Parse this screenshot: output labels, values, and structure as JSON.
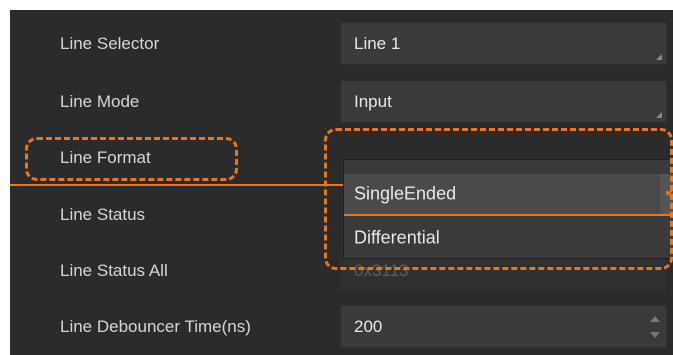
{
  "properties": [
    {
      "label": "Line Selector",
      "value": "Line 1"
    },
    {
      "label": "Line Mode",
      "value": "Input"
    },
    {
      "label": "Line Format",
      "value": ""
    },
    {
      "label": "Line Status",
      "value": ""
    },
    {
      "label": "Line Status All",
      "value": "0x3113"
    },
    {
      "label": "Line Debouncer Time(ns)",
      "value": "200"
    }
  ],
  "dropdown": {
    "options": [
      "SingleEnded",
      "Differential"
    ],
    "selected": "SingleEnded",
    "check_icon": "check-icon"
  },
  "colors": {
    "accent": "#e9751f",
    "panel": "#2b2b2b",
    "field": "#3a3a3a",
    "label_text": "#d6d6d6",
    "disabled_text": "#5e5e5e"
  }
}
